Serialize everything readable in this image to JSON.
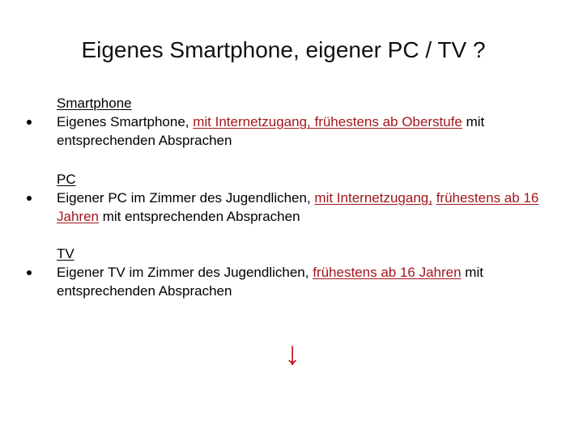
{
  "title": "Eigenes Smartphone, eigener PC / TV ?",
  "sections": [
    {
      "heading": "Smartphone",
      "parts": [
        {
          "text": "Eigenes Smartphone, ",
          "highlight": false
        },
        {
          "text": "mit Internetzugang, frühestens ab Oberstufe",
          "highlight": true
        },
        {
          "text": " mit entsprechenden Absprachen",
          "highlight": false
        }
      ]
    },
    {
      "heading": "PC",
      "parts": [
        {
          "text": "Eigener PC im Zimmer des Jugendlichen, ",
          "highlight": false
        },
        {
          "text": "mit Internetzugang,",
          "highlight": true
        },
        {
          "text": " ",
          "highlight": false
        },
        {
          "text": "frühestens ab 16 Jahren",
          "highlight": true
        },
        {
          "text": " mit entsprechenden Absprachen",
          "highlight": false
        }
      ]
    },
    {
      "heading": "TV",
      "parts": [
        {
          "text": "Eigener TV im Zimmer des Jugendlichen, ",
          "highlight": false
        },
        {
          "text": "frühestens ab 16 Jahren",
          "highlight": true
        },
        {
          "text": " mit entsprechenden Absprachen",
          "highlight": false
        }
      ]
    }
  ],
  "arrow": {
    "icon": "arrow-down-icon",
    "glyph": "↓"
  },
  "colors": {
    "highlight": "#a3161c",
    "arrow": "#c4161c"
  }
}
